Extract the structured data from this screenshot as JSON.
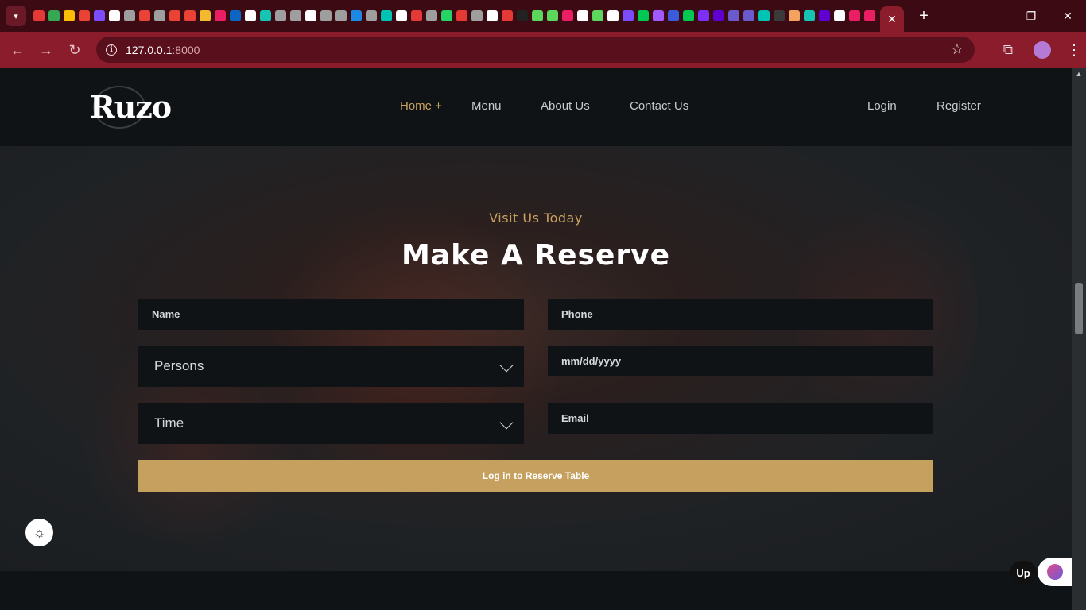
{
  "browser": {
    "url_host": "127.0.0.1",
    "url_port": ":8000",
    "pinned_tab_colors": [
      "#e53935",
      "#34a853",
      "#fbbc04",
      "#ea4335",
      "#7c4dff",
      "#ffffff",
      "#9e9e9e",
      "#ea4335",
      "#9e9e9e",
      "#ea4335",
      "#ea4335",
      "#f3ba2f",
      "#e91e63",
      "#0a66c2",
      "#ffffff",
      "#17c3b2",
      "#9e9e9e",
      "#9e9e9e",
      "#ffffff",
      "#9e9e9e",
      "#9e9e9e",
      "#1e88e5",
      "#9e9e9e",
      "#00c4b3",
      "#ffffff",
      "#e53935",
      "#9e9e9e",
      "#25d366",
      "#e53935",
      "#9e9e9e",
      "#ffffff",
      "#e53935",
      "#222222",
      "#5cd65c",
      "#5cd65c",
      "#e91e63",
      "#ffffff",
      "#5cd65c",
      "#ffffff",
      "#7c4dff",
      "#00c853",
      "#a259ff",
      "#3b5bdb",
      "#00c853",
      "#7b2ff7",
      "#6001d2",
      "#6a5acd",
      "#6a5acd",
      "#00c4b3",
      "#3a3a3a",
      "#f4a261",
      "#17c3b2",
      "#6001d2",
      "#ffffff",
      "#e91e63",
      "#e91e63"
    ],
    "active_tab_close": "✕",
    "new_tab": "+",
    "window_controls": [
      "–",
      "❐",
      "✕"
    ]
  },
  "site": {
    "logo": "Ruzo",
    "nav": [
      {
        "label": "Home +",
        "active": true
      },
      {
        "label": "Menu",
        "active": false
      },
      {
        "label": "About Us",
        "active": false
      },
      {
        "label": "Contact Us",
        "active": false
      }
    ],
    "auth": {
      "login": "Login",
      "register": "Register"
    }
  },
  "reservation": {
    "eyebrow": "Visit Us Today",
    "title": "Make A Reserve",
    "name_placeholder": "Name",
    "phone_placeholder": "Phone",
    "persons_label": "Persons",
    "date_placeholder": "mm/dd/yyyy",
    "time_label": "Time",
    "email_placeholder": "Email",
    "submit_label": "Log in to Reserve Table"
  },
  "widgets": {
    "up_badge": "Up"
  },
  "colors": {
    "accent_gold": "#c6a05f",
    "header_bg": "#0f1316",
    "browser_red": "#8a1c2c"
  }
}
